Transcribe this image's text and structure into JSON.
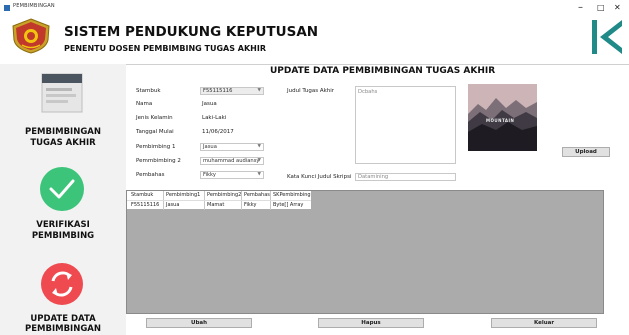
{
  "window": {
    "title": "PEMBIMBINGAN",
    "minimize": "–",
    "maximize": "□",
    "close": "✕"
  },
  "header": {
    "title": "SISTEM PENDUKUNG KEPUTUSAN",
    "subtitle": "PENENTU DOSEN PEMBIMBING TUGAS AKHIR"
  },
  "sidebar": {
    "items": [
      {
        "label_line1": "PEMBIMBINGAN",
        "label_line2": "TUGAS AKHIR",
        "icon": "document-form-icon"
      },
      {
        "label_line1": "VERIFIKASI",
        "label_line2": "PEMBIMBING",
        "icon": "checkmark-circle-icon"
      },
      {
        "label_line1": "UPDATE DATA",
        "label_line2": "PEMBIMBINGAN",
        "icon": "refresh-circle-icon"
      }
    ]
  },
  "form": {
    "title": "UPDATE DATA PEMBIMBINGAN TUGAS AKHIR",
    "stambuk_label": "Stambuk",
    "stambuk_value": "F55115116",
    "nama_label": "Nama",
    "nama_value": "Jasua",
    "jenis_kelamin_label": "Jenis Kelamin",
    "jenis_kelamin_value": "Laki-Laki",
    "tanggal_mulai_label": "Tanggal Mulai",
    "tanggal_mulai_value": "11/06/2017",
    "pembimbing1_label": "Pembimbing 1",
    "pembimbing1_value": "Jasua",
    "pembimbing2_label": "Pemmbimbing 2",
    "pembimbing2_value": "muhammad audiansy",
    "pembahas_label": "Pembahas",
    "pembahas_value": "Fikky",
    "judul_label": "Judul Tugas Akhir",
    "judul_value": "Dcbahs",
    "kata_kunci_label": "Kata Kunci Judul Skripsi",
    "kata_kunci_value": "Datamining",
    "upload_button": "Upload"
  },
  "grid": {
    "headers": [
      "Stambuk",
      "Pembimbing1",
      "Pembimbing2",
      "Pembahas",
      "SKPembimbing"
    ],
    "rows": [
      [
        "F55115116",
        "Jasua",
        "Mamat",
        "Fikky",
        "Byte[] Array"
      ]
    ]
  },
  "actions": {
    "ubah": "Ubah",
    "hapus": "Hapus",
    "keluar": "Keluar"
  },
  "image_text": "MOUNTAIN",
  "colors": {
    "sidebar_bg": "#f2f2f2",
    "check_green": "#3cc47a",
    "refresh_red": "#ee4a50",
    "back_teal": "#1f8a87",
    "grid_bg": "#ababab"
  }
}
